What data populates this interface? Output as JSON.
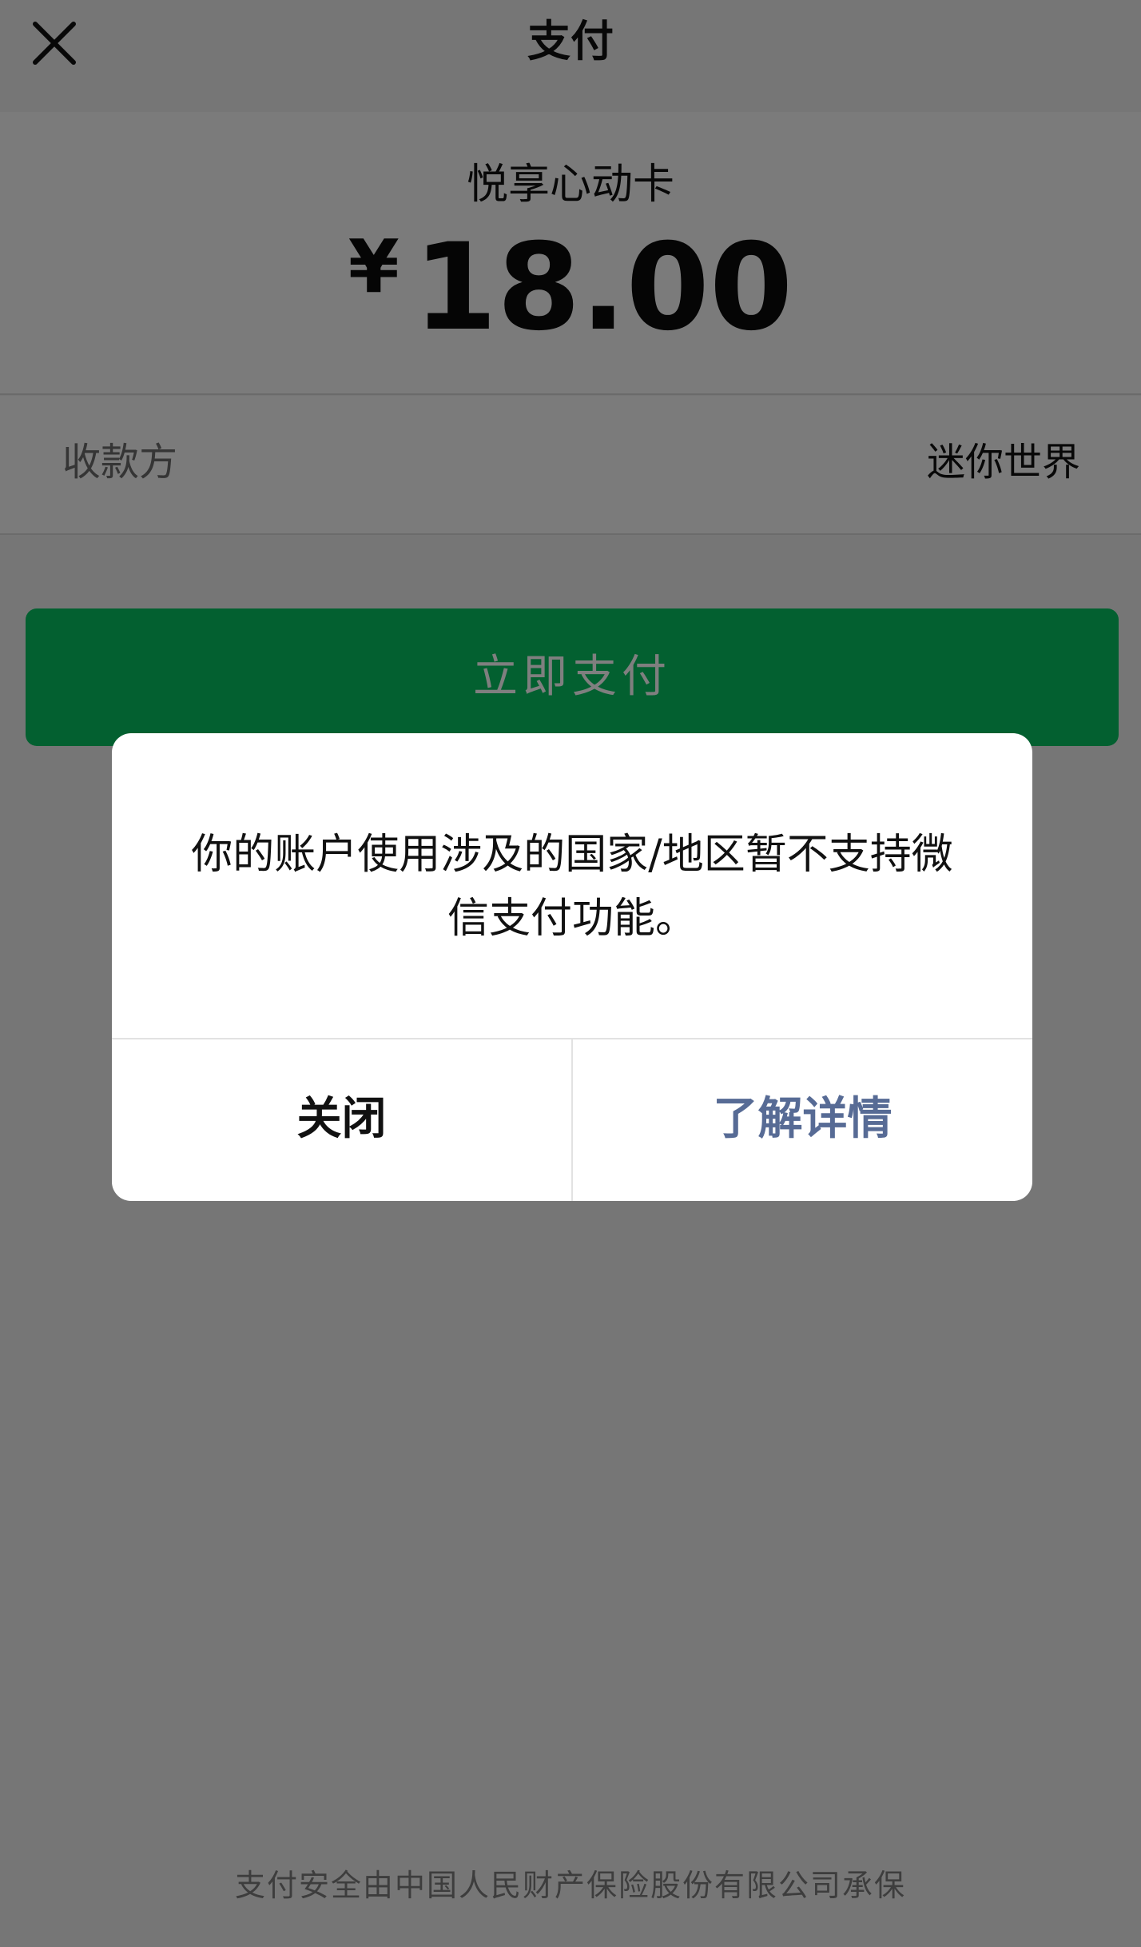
{
  "header": {
    "title": "支付",
    "close_icon": "close-icon"
  },
  "amount_card": {
    "product_name": "悦享心动卡",
    "currency_symbol": "¥",
    "amount": "18.00"
  },
  "payee": {
    "label": "收款方",
    "value": "迷你世界"
  },
  "pay_button": {
    "label": "立即支付",
    "color": "#07c160"
  },
  "footer": {
    "text": "支付安全由中国人民财产保险股份有限公司承保"
  },
  "dialog": {
    "message": "你的账户使用涉及的国家/地区暂不支持微信支付功能。",
    "close_label": "关闭",
    "learn_more_label": "了解详情",
    "link_color": "#576b95"
  }
}
